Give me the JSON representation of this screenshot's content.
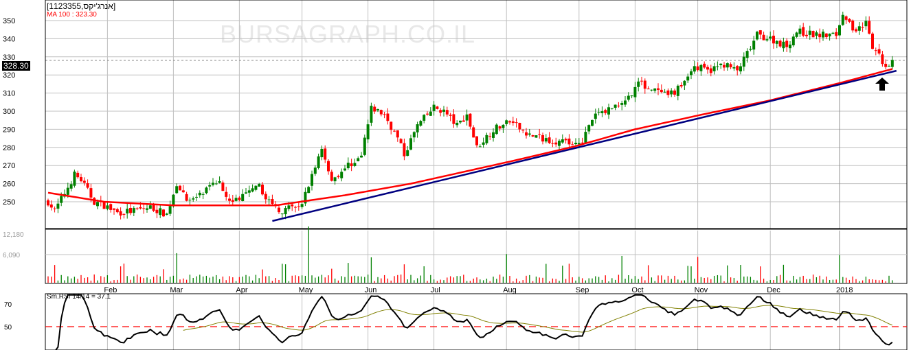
{
  "header": {
    "symbol": "[1123355,אנרג'יקס]",
    "ma_label": "MA 100 : 323.30",
    "watermark": "BURSAGRAPH.CO.IL",
    "last_price": "328.30",
    "rsi_label": "Sm.RSI 14/14 = 37.1"
  },
  "colors": {
    "up": "#008000",
    "down": "#ff0000",
    "ma": "#ff0000",
    "trend": "#000080",
    "rsi": "#000000",
    "rsi_signal": "#808000",
    "grid": "#c0c0c0"
  },
  "chart_data": {
    "type": "candlestick",
    "title": "[1123355,אנרג'יקס]",
    "price_axis": {
      "ticks": [
        "250",
        "260",
        "270",
        "280",
        "290",
        "300",
        "310",
        "320",
        "330",
        "340",
        "350"
      ],
      "range": [
        235,
        361
      ]
    },
    "month_labels": [
      {
        "label": "Feb",
        "day": 18
      },
      {
        "label": "Mar",
        "day": 38
      },
      {
        "label": "Apr",
        "day": 58
      },
      {
        "label": "May",
        "day": 77
      },
      {
        "label": "Jun",
        "day": 97
      },
      {
        "label": "Jul",
        "day": 117
      },
      {
        "label": "Aug",
        "day": 139
      },
      {
        "label": "Sep",
        "day": 161
      },
      {
        "label": "Oct",
        "day": 178
      },
      {
        "label": "Nov",
        "day": 197
      },
      {
        "label": "Dec",
        "day": 219
      },
      {
        "label": "2018",
        "day": 240
      }
    ],
    "close_keypoints": [
      [
        0,
        250
      ],
      [
        2,
        245
      ],
      [
        6,
        258
      ],
      [
        8,
        265
      ],
      [
        10,
        262
      ],
      [
        14,
        250
      ],
      [
        17,
        248
      ],
      [
        21,
        244
      ],
      [
        26,
        245
      ],
      [
        31,
        247
      ],
      [
        36,
        243
      ],
      [
        39,
        260
      ],
      [
        43,
        250
      ],
      [
        48,
        256
      ],
      [
        52,
        262
      ],
      [
        55,
        250
      ],
      [
        58,
        252
      ],
      [
        64,
        258
      ],
      [
        68,
        248
      ],
      [
        71,
        245
      ],
      [
        77,
        248
      ],
      [
        79,
        260
      ],
      [
        83,
        280
      ],
      [
        86,
        262
      ],
      [
        91,
        270
      ],
      [
        95,
        275
      ],
      [
        98,
        302
      ],
      [
        102,
        298
      ],
      [
        106,
        285
      ],
      [
        108,
        276
      ],
      [
        112,
        292
      ],
      [
        117,
        302
      ],
      [
        120,
        300
      ],
      [
        124,
        292
      ],
      [
        127,
        298
      ],
      [
        130,
        280
      ],
      [
        135,
        290
      ],
      [
        140,
        294
      ],
      [
        146,
        287
      ],
      [
        150,
        285
      ],
      [
        158,
        282
      ],
      [
        162,
        284
      ],
      [
        166,
        298
      ],
      [
        171,
        302
      ],
      [
        176,
        308
      ],
      [
        179,
        316
      ],
      [
        183,
        312
      ],
      [
        188,
        308
      ],
      [
        192,
        314
      ],
      [
        196,
        325
      ],
      [
        200,
        322
      ],
      [
        205,
        326
      ],
      [
        209,
        322
      ],
      [
        213,
        335
      ],
      [
        215,
        342
      ],
      [
        219,
        340
      ],
      [
        224,
        336
      ],
      [
        227,
        344
      ],
      [
        233,
        342
      ],
      [
        239,
        342
      ],
      [
        241,
        355
      ],
      [
        244,
        345
      ],
      [
        248,
        348
      ],
      [
        250,
        335
      ],
      [
        254,
        325
      ],
      [
        256,
        328.3
      ]
    ],
    "ma100_keypoints": [
      [
        0,
        255
      ],
      [
        17,
        250
      ],
      [
        38,
        248
      ],
      [
        69,
        248
      ],
      [
        90,
        253.6
      ],
      [
        110,
        260
      ],
      [
        142,
        273
      ],
      [
        160,
        280.7
      ],
      [
        178,
        290
      ],
      [
        198,
        298
      ],
      [
        219,
        306
      ],
      [
        240,
        315.5
      ],
      [
        256,
        323.3
      ]
    ],
    "trendline": [
      [
        68,
        239.4
      ],
      [
        256,
        322.3
      ]
    ],
    "volume_axis": {
      "ticks": [
        "6,090",
        "12,180"
      ],
      "max": 12180
    },
    "volume_spikes": [
      [
        39,
        6400
      ],
      [
        79,
        12180
      ],
      [
        98,
        5500
      ],
      [
        139,
        6200
      ],
      [
        174,
        5800
      ],
      [
        197,
        5600
      ],
      [
        240,
        6000
      ]
    ],
    "rsi_axis": {
      "ticks": [
        "50",
        "70"
      ],
      "reference": 50,
      "period": 14
    },
    "rsi_last": 37.1,
    "ma_last": 323.3,
    "last_close": 328.3
  }
}
